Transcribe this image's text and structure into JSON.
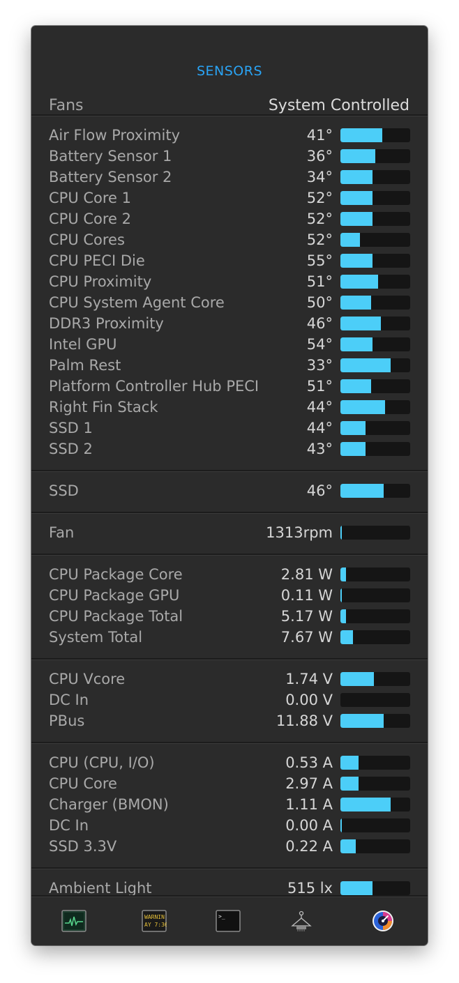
{
  "window": {
    "title": "SENSORS"
  },
  "fans": {
    "label": "Fans",
    "value": "System Controlled"
  },
  "sections": [
    {
      "id": "temperatures",
      "rows": [
        {
          "name": "Air Flow Proximity",
          "value": "41°",
          "level": 0.6
        },
        {
          "name": "Battery Sensor 1",
          "value": "36°",
          "level": 0.5
        },
        {
          "name": "Battery Sensor 2",
          "value": "34°",
          "level": 0.46
        },
        {
          "name": "CPU Core 1",
          "value": "52°",
          "level": 0.46
        },
        {
          "name": "CPU Core 2",
          "value": "52°",
          "level": 0.46
        },
        {
          "name": "CPU Cores",
          "value": "52°",
          "level": 0.28
        },
        {
          "name": "CPU PECI Die",
          "value": "55°",
          "level": 0.46
        },
        {
          "name": "CPU Proximity",
          "value": "51°",
          "level": 0.54
        },
        {
          "name": "CPU System Agent Core",
          "value": "50°",
          "level": 0.44
        },
        {
          "name": "DDR3 Proximity",
          "value": "46°",
          "level": 0.58
        },
        {
          "name": "Intel GPU",
          "value": "54°",
          "level": 0.46
        },
        {
          "name": "Palm Rest",
          "value": "33°",
          "level": 0.72
        },
        {
          "name": "Platform Controller Hub PECI",
          "value": "51°",
          "level": 0.44
        },
        {
          "name": "Right Fin Stack",
          "value": "44°",
          "level": 0.64
        },
        {
          "name": "SSD 1",
          "value": "44°",
          "level": 0.36
        },
        {
          "name": "SSD 2",
          "value": "43°",
          "level": 0.36
        }
      ]
    },
    {
      "id": "ssd",
      "rows": [
        {
          "name": "SSD",
          "value": "46°",
          "level": 0.62
        }
      ]
    },
    {
      "id": "fan",
      "rows": [
        {
          "name": "Fan",
          "value": "1313rpm",
          "level": 0.02
        }
      ]
    },
    {
      "id": "power",
      "rows": [
        {
          "name": "CPU Package Core",
          "value": "2.81 W",
          "level": 0.08
        },
        {
          "name": "CPU Package GPU",
          "value": "0.11 W",
          "level": 0.02
        },
        {
          "name": "CPU Package Total",
          "value": "5.17 W",
          "level": 0.08
        },
        {
          "name": "System Total",
          "value": "7.67 W",
          "level": 0.18
        }
      ]
    },
    {
      "id": "voltage",
      "rows": [
        {
          "name": "CPU Vcore",
          "value": "1.74 V",
          "level": 0.48
        },
        {
          "name": "DC In",
          "value": "0.00 V",
          "level": 0.0
        },
        {
          "name": "PBus",
          "value": "11.88 V",
          "level": 0.62
        }
      ]
    },
    {
      "id": "current",
      "rows": [
        {
          "name": "CPU (CPU, I/O)",
          "value": "0.53 A",
          "level": 0.26
        },
        {
          "name": "CPU Core",
          "value": "2.97 A",
          "level": 0.26
        },
        {
          "name": "Charger (BMON)",
          "value": "1.11 A",
          "level": 0.72
        },
        {
          "name": "DC In",
          "value": "0.00 A",
          "level": 0.02
        },
        {
          "name": "SSD 3.3V",
          "value": "0.22 A",
          "level": 0.22
        }
      ]
    },
    {
      "id": "light",
      "rows": [
        {
          "name": "Ambient Light",
          "value": "515 lx",
          "level": 0.46
        }
      ]
    }
  ],
  "toolbar": {
    "console_text_line1": "WARNIN",
    "console_text_line2": "AY 7:36",
    "terminal_prompt": ">_",
    "buttons": [
      {
        "icon": "activity-monitor-icon"
      },
      {
        "icon": "console-icon"
      },
      {
        "icon": "terminal-icon"
      },
      {
        "icon": "system-information-icon"
      },
      {
        "icon": "istat-menus-icon"
      }
    ]
  },
  "colors": {
    "accent": "#2aa4f5",
    "bar_fill": "#4ccef8",
    "bar_track": "#151515",
    "panel_bg": "#2b2b2b"
  }
}
